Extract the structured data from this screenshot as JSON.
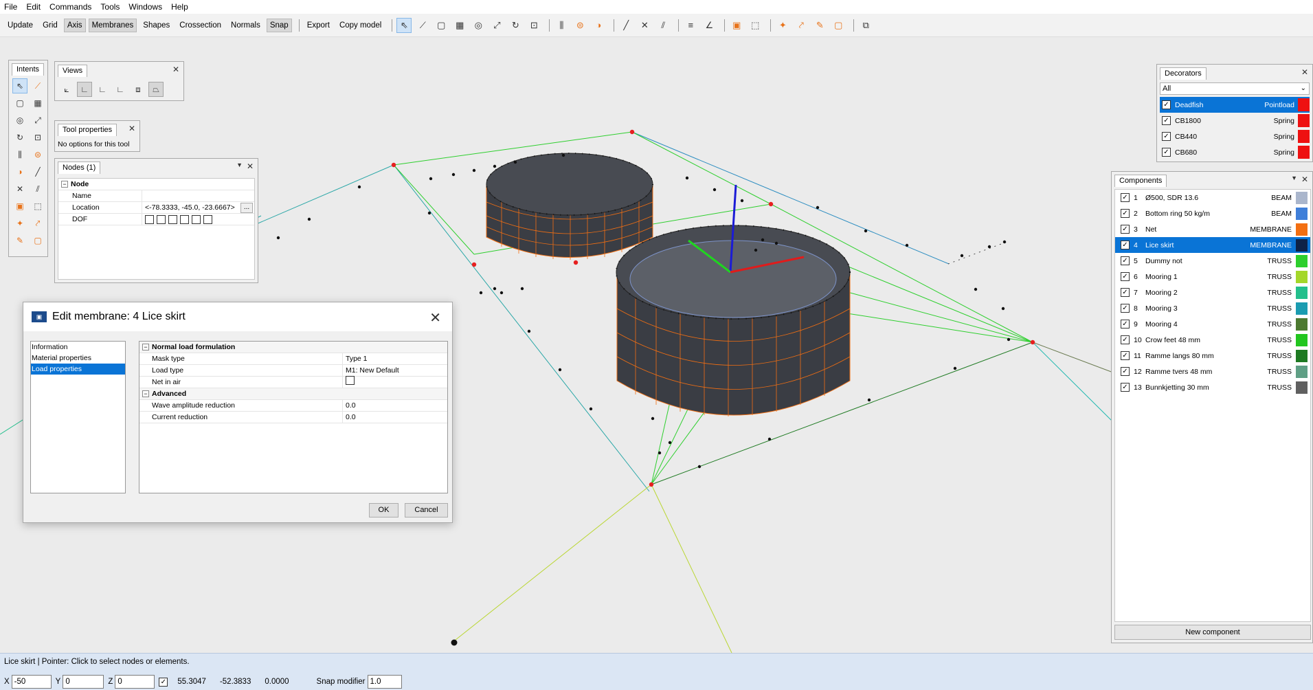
{
  "menu": [
    "File",
    "Edit",
    "Commands",
    "Tools",
    "Windows",
    "Help"
  ],
  "toolbar": {
    "buttons": [
      {
        "label": "Update",
        "active": false
      },
      {
        "label": "Grid",
        "active": false
      },
      {
        "label": "Axis",
        "active": true
      },
      {
        "label": "Membranes",
        "active": true
      },
      {
        "label": "Shapes",
        "active": false
      },
      {
        "label": "Crossection",
        "active": false
      },
      {
        "label": "Normals",
        "active": false
      },
      {
        "label": "Snap",
        "active": true
      }
    ],
    "export_label": "Export",
    "copy_label": "Copy model"
  },
  "intents": {
    "title": "Intents"
  },
  "views": {
    "title": "Views"
  },
  "tool_properties": {
    "title": "Tool properties",
    "text": "No options for this tool"
  },
  "nodes": {
    "title": "Nodes (1)",
    "group": "Node",
    "rows": [
      {
        "key": "Name",
        "value": ""
      },
      {
        "key": "Location",
        "value": "<-78.3333, -45.0, -23.6667>"
      },
      {
        "key": "DOF",
        "value": ""
      }
    ],
    "dots": "..."
  },
  "decorators": {
    "title": "Decorators",
    "filter": "All",
    "items": [
      {
        "name": "Deadfish",
        "type": "Pointload",
        "color": "#ee1111",
        "selected": true
      },
      {
        "name": "CB1800",
        "type": "Spring",
        "color": "#ee1111",
        "selected": false
      },
      {
        "name": "CB440",
        "type": "Spring",
        "color": "#ee1111",
        "selected": false
      },
      {
        "name": "CB680",
        "type": "Spring",
        "color": "#ee1111",
        "selected": false
      }
    ]
  },
  "components": {
    "title": "Components",
    "new_label": "New component",
    "items": [
      {
        "num": "1",
        "name": "Ø500, SDR 13.6",
        "type": "BEAM",
        "color": "#aab6cc",
        "selected": false
      },
      {
        "num": "2",
        "name": "Bottom ring 50 kg/m",
        "type": "BEAM",
        "color": "#3f7fd9",
        "selected": false
      },
      {
        "num": "3",
        "name": "Net",
        "type": "MEMBRANE",
        "color": "#f36f12",
        "selected": false
      },
      {
        "num": "4",
        "name": "Lice skirt",
        "type": "MEMBRANE",
        "color": "#0e2247",
        "selected": true
      },
      {
        "num": "5",
        "name": "Dummy not",
        "type": "TRUSS",
        "color": "#2dcf2d",
        "selected": false
      },
      {
        "num": "6",
        "name": "Mooring 1",
        "type": "TRUSS",
        "color": "#a4d72a",
        "selected": false
      },
      {
        "num": "7",
        "name": "Mooring 2",
        "type": "TRUSS",
        "color": "#23bf8c",
        "selected": false
      },
      {
        "num": "8",
        "name": "Mooring 3",
        "type": "TRUSS",
        "color": "#1b9cb1",
        "selected": false
      },
      {
        "num": "9",
        "name": "Mooring 4",
        "type": "TRUSS",
        "color": "#4d7a31",
        "selected": false
      },
      {
        "num": "10",
        "name": "Crow feet 48 mm",
        "type": "TRUSS",
        "color": "#22c61f",
        "selected": false
      },
      {
        "num": "11",
        "name": "Ramme langs 80 mm",
        "type": "TRUSS",
        "color": "#1e7a22",
        "selected": false
      },
      {
        "num": "12",
        "name": "Ramme tvers 48 mm",
        "type": "TRUSS",
        "color": "#5f9f85",
        "selected": false
      },
      {
        "num": "13",
        "name": "Bunnkjetting 30 mm",
        "type": "TRUSS",
        "color": "#606060",
        "selected": false
      }
    ]
  },
  "dialog": {
    "title": "Edit membrane: 4 Lice skirt",
    "nav": [
      {
        "label": "Information",
        "selected": false
      },
      {
        "label": "Material properties",
        "selected": false
      },
      {
        "label": "Load properties",
        "selected": true
      }
    ],
    "group1": "Normal load formulation",
    "mask_type_label": "Mask type",
    "mask_type_value": "Type 1",
    "load_type_label": "Load type",
    "load_type_value": "M1: New Default",
    "net_in_air_label": "Net in air",
    "group2": "Advanced",
    "wave_label": "Wave amplitude reduction",
    "wave_value": "0.0",
    "current_label": "Current reduction",
    "current_value": "0.0",
    "ok": "OK",
    "cancel": "Cancel"
  },
  "status": {
    "text": "Lice skirt | Pointer: Click to select nodes or elements.",
    "x_label": "X",
    "x": "-50",
    "y_label": "Y",
    "y": "0",
    "z_label": "Z",
    "z": "0",
    "readout1": "55.3047",
    "readout2": "-52.3833",
    "readout3": "0.0000",
    "snap_label": "Snap modifier",
    "snap": "1.0"
  }
}
